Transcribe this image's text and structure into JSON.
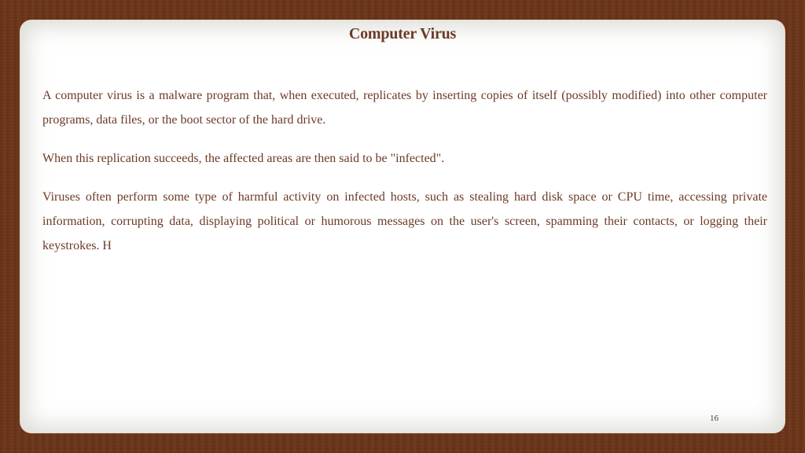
{
  "slide": {
    "title": "Computer Virus",
    "paragraphs": [
      "A computer virus is a malware program that, when executed, replicates by inserting copies of itself (possibly modified) into other computer programs, data files, or the boot sector of the hard drive.",
      "When this replication succeeds, the affected areas are then said to be \"infected\".",
      "Viruses often perform some type of harmful activity on infected hosts, such as stealing hard disk space or CPU time, accessing private information, corrupting data, displaying political or humorous messages on the user's screen, spamming their contacts, or logging their keystrokes. H"
    ],
    "page_number": "16"
  },
  "colors": {
    "background": "#6a3419",
    "panel": "#ffffff",
    "text": "#6b3a26"
  }
}
